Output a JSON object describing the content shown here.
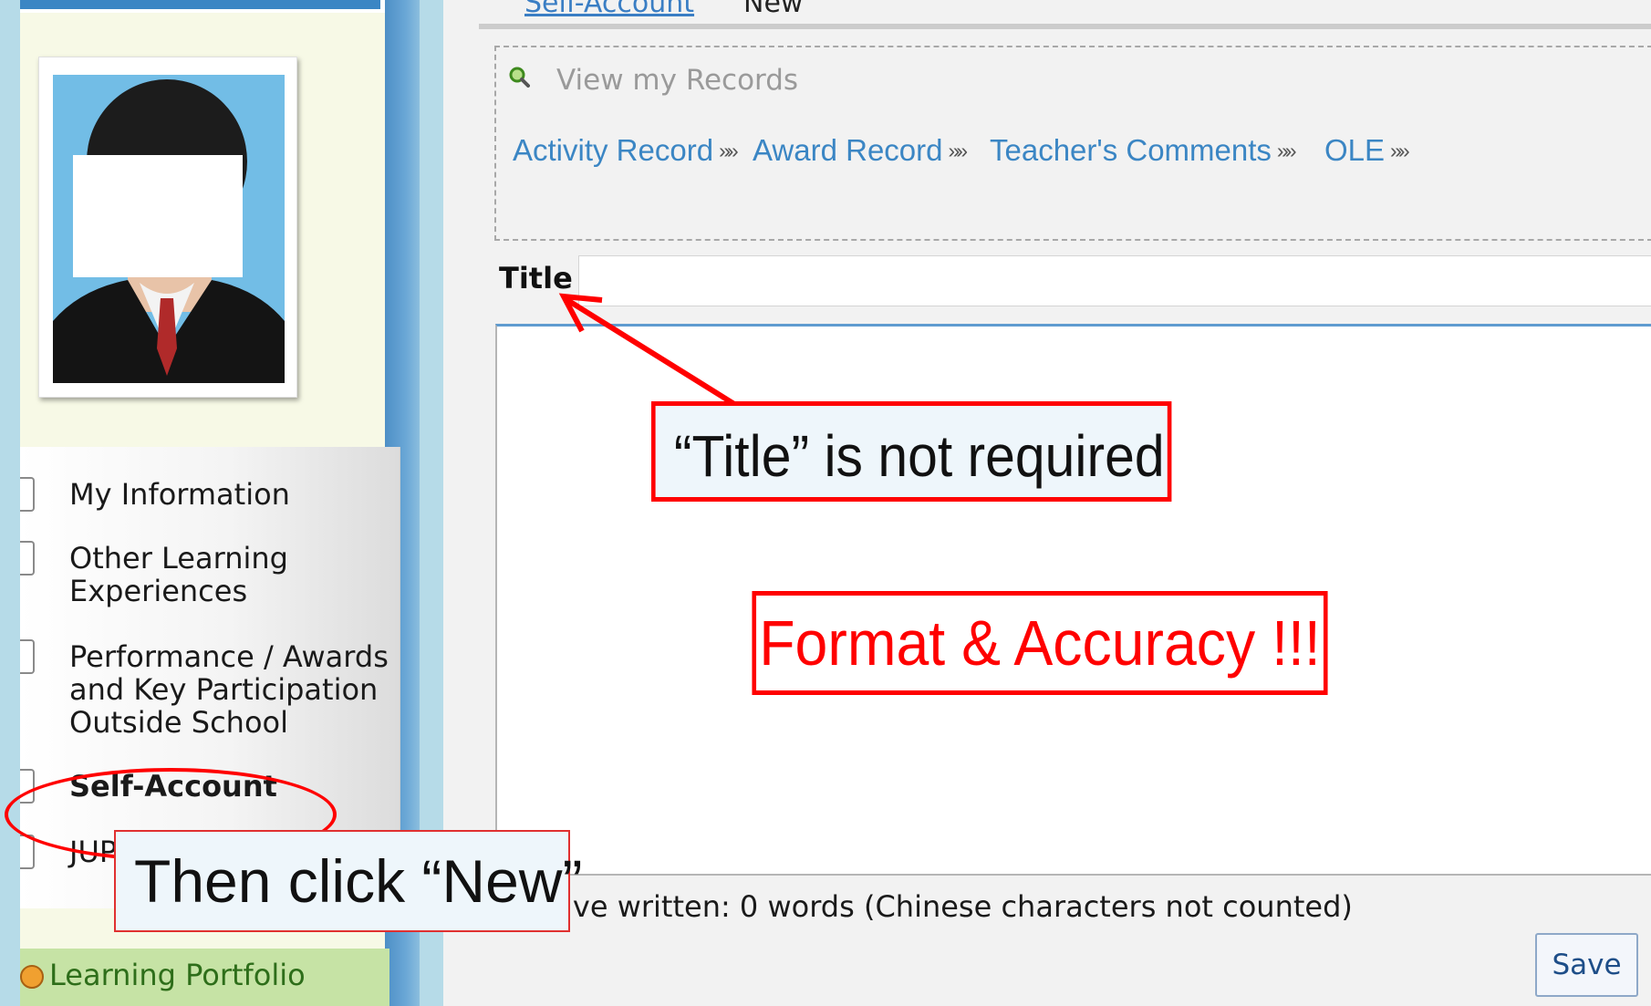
{
  "top_partial": {
    "link": "Self-Account",
    "text": "New"
  },
  "profile": {
    "photo_label": "student-photo"
  },
  "sidebar": {
    "items": [
      {
        "label": "My Information"
      },
      {
        "label": "Other Learning"
      },
      {
        "label": "Experiences"
      },
      {
        "label": "Performance / Awards"
      },
      {
        "label": "and Key Participation"
      },
      {
        "label": "Outside School"
      },
      {
        "label": "Self-Account"
      },
      {
        "label": "JUPA"
      }
    ],
    "portfolio_label": "Learning Portfolio"
  },
  "records": {
    "heading": "View my Records",
    "links": [
      {
        "label": "Activity Record",
        "chev": "»»"
      },
      {
        "label": "Award Record",
        "chev": "»»"
      },
      {
        "label": "Teacher's Comments",
        "chev": "»»"
      },
      {
        "label": "OLE",
        "chev": "»»"
      }
    ]
  },
  "form": {
    "title_label": "Title",
    "title_value": "",
    "word_count": "have written: 0 words (Chinese characters not counted)",
    "save_label": "Save"
  },
  "annotations": {
    "title_note": "“Title” is not required",
    "format_note": "Format & Accuracy !!!",
    "new_note": "Then click “New”"
  },
  "colors": {
    "annotation_red": "#ff0000",
    "link_blue": "#3b86c4",
    "sidebar_divider": "#4d8fc6"
  }
}
